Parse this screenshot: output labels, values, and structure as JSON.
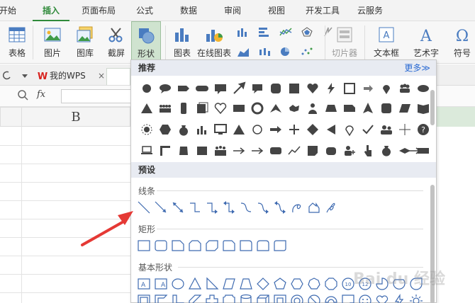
{
  "tabs": [
    "开始",
    "插入",
    "页面布局",
    "公式",
    "数据",
    "审阅",
    "视图",
    "开发工具",
    "云服务"
  ],
  "ribbon": {
    "table": "表格",
    "picture": "图片",
    "gallery": "图库",
    "screenshot": "截屏",
    "shapes": "形状",
    "chart": "图表",
    "online_chart": "在线图表",
    "slicer": "切片器",
    "textbox": "文本框",
    "wordart": "艺术字",
    "symbol": "符号"
  },
  "wps_tab": "我的WPS",
  "fx": "fx",
  "column_b": "B",
  "panel": {
    "recommend": "推荐",
    "more": "更多≫",
    "preset": "预设",
    "lines": "线条",
    "rect": "矩形",
    "basic": "基本形状"
  },
  "watermark": "Bai du 经验"
}
